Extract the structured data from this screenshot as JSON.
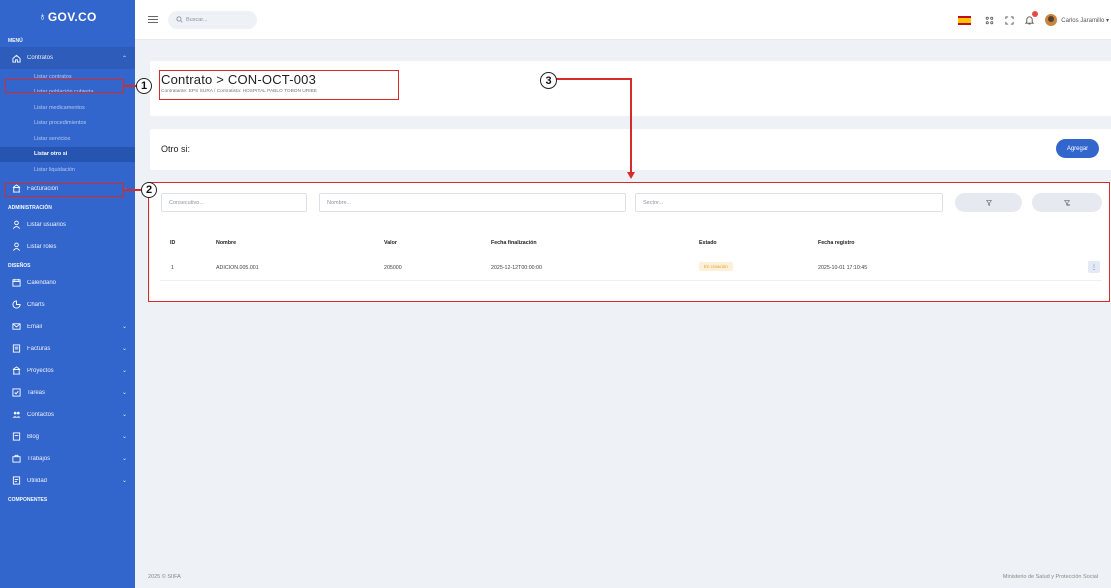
{
  "brand": {
    "logo": "GOV.CO"
  },
  "sidebar": {
    "sections": [
      {
        "title": "MENÚ"
      },
      {
        "title": "ADMINISTRACIÓN"
      },
      {
        "title": "DISEÑOS"
      },
      {
        "title": "COMPONENTES"
      }
    ],
    "items": {
      "contratos": "Contratos",
      "sub": [
        "Listar contratos",
        "Listar población cubierta",
        "Listar medicamentos",
        "Listar procedimientos",
        "Listar servicios",
        "Listar otro si",
        "Listar liquidación"
      ],
      "facturacion": "Facturación",
      "usuarios": "Listar usuarios",
      "roles": "Listar roles",
      "calendario": "Calendario",
      "charts": "Charts",
      "email": "Email",
      "facturas": "Facturas",
      "proyectos": "Proyectos",
      "tareas": "Tareas",
      "contactos": "Contactos",
      "blog": "Blog",
      "trabajos": "Trabajos",
      "utilidad": "Utilidad"
    }
  },
  "topbar": {
    "search_placeholder": "Buscar...",
    "user_name": "Carlos Jaramillo ▾"
  },
  "header": {
    "title": "Contrato > CON-OCT-003",
    "subtitle": "Contratante: EPS SURA / Contratista: HOSPITAL PABLO TOBON URIBE"
  },
  "otro_si": {
    "title": "Otro si:",
    "add_label": "Agregar"
  },
  "filters": {
    "consecutivo": "Consecutivo...",
    "nombre": "Nombre...",
    "sector": "Sector...",
    "filter_icon": "filter-icon",
    "clear_icon": "clear-filter-icon"
  },
  "table": {
    "headers": [
      "ID",
      "Nombre",
      "Valor",
      "Fecha finalización",
      "Estado",
      "Fecha registro"
    ],
    "rows": [
      {
        "id": "1",
        "nombre": "ADICION.005.001",
        "valor": "205000",
        "fecha_fin": "2025-12-12T00:00:00",
        "estado": "En creación",
        "fecha_registro": "2025-10-01 17:10:45",
        "action": "⋮"
      }
    ]
  },
  "annotations": [
    "1",
    "2",
    "3"
  ],
  "footer": {
    "left": "2025 © SIIFA",
    "right": "Ministerio de Salud y Protección Social"
  },
  "colors": {
    "sidebar": "#3366cc",
    "accent": "#3366cc",
    "annotation": "#d72b2b",
    "badge_text": "#e4a12d"
  }
}
